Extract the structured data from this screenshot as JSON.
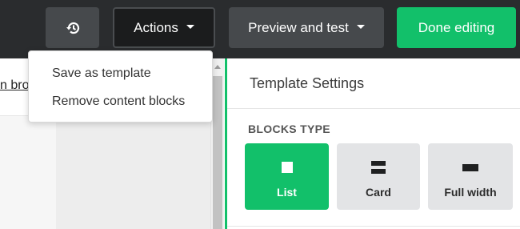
{
  "toolbar": {
    "history_icon": "history-icon",
    "actions_label": "Actions",
    "preview_label": "Preview and test",
    "done_label": "Done editing",
    "accent_color": "#12c06a"
  },
  "actions_menu": {
    "items": [
      {
        "label": "Save as template"
      },
      {
        "label": "Remove content blocks"
      }
    ]
  },
  "content": {
    "link_text": "n bro"
  },
  "settings": {
    "title": "Template Settings",
    "blocks_type_label": "BLOCKS TYPE",
    "options": [
      {
        "label": "List",
        "icon": "square-icon",
        "selected": true
      },
      {
        "label": "Card",
        "icon": "card-icon",
        "selected": false
      },
      {
        "label": "Full width",
        "icon": "full-width-icon",
        "selected": false
      }
    ]
  }
}
